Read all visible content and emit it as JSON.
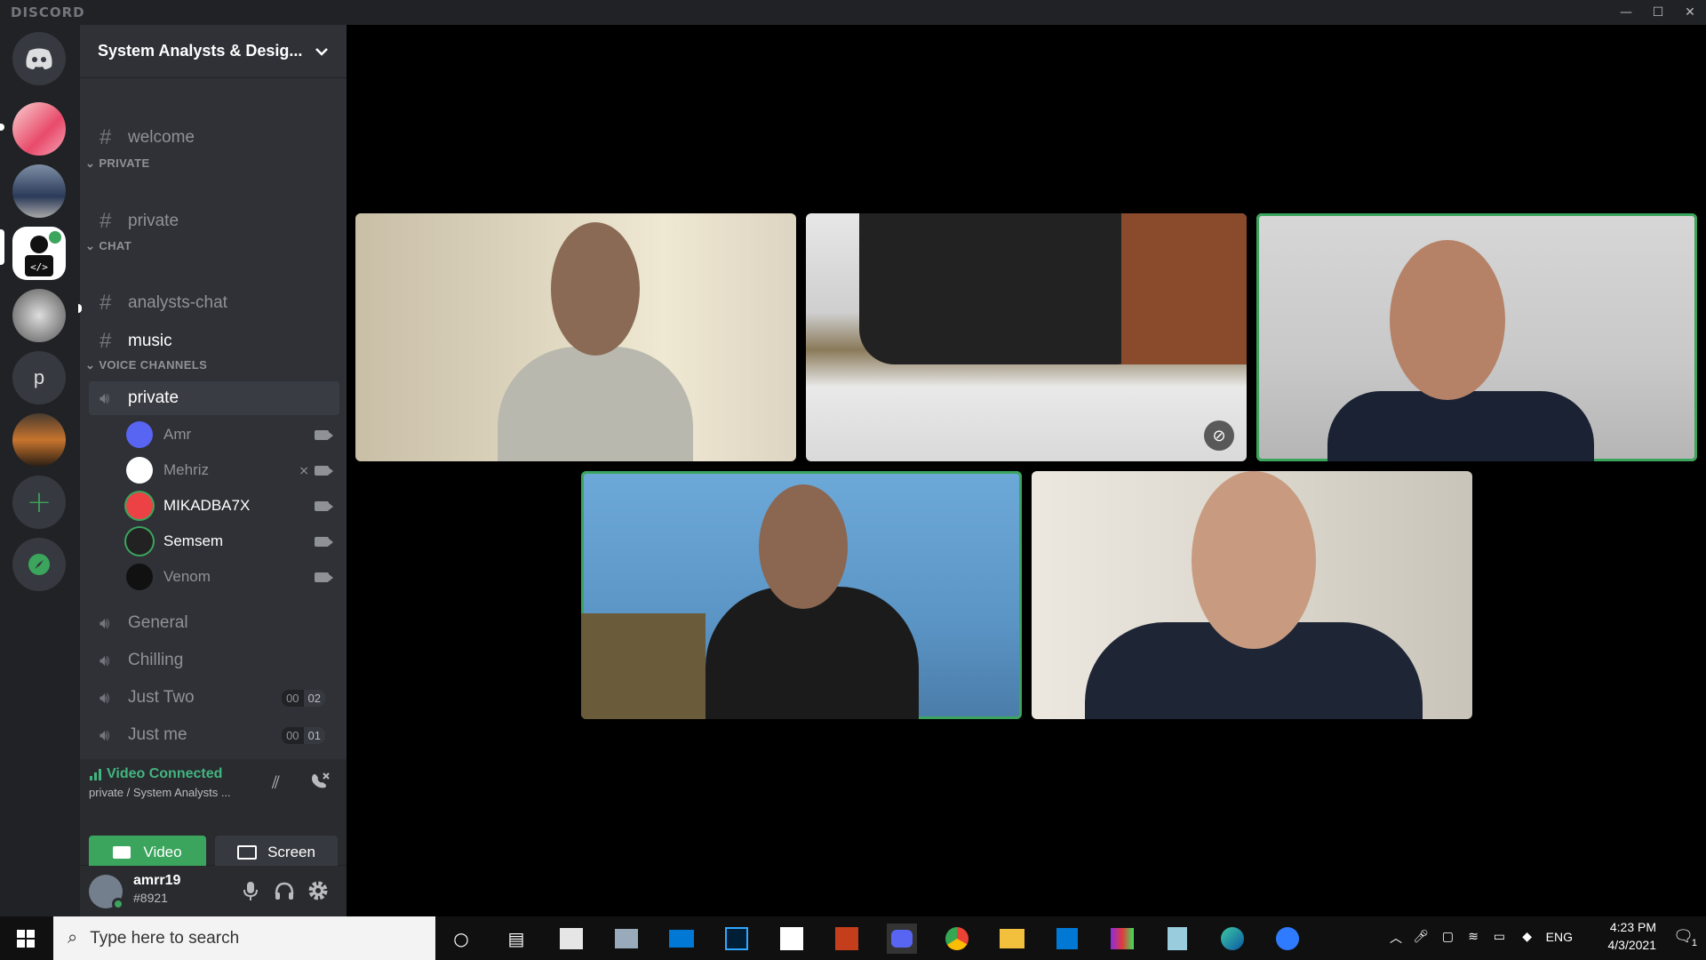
{
  "app": {
    "brand": "DISCORD"
  },
  "window_controls": [
    "—",
    "☐",
    "✕"
  ],
  "server": {
    "name": "System Analysts & Desig..."
  },
  "channels": {
    "welcome": "welcome",
    "cat_private": "PRIVATE",
    "private": "private",
    "cat_chat": "CHAT",
    "analysts_chat": "analysts-chat",
    "music": "music",
    "cat_voice": "VOICE CHANNELS",
    "voice_private": "private",
    "voice_general": "General",
    "voice_chilling": "Chilling",
    "voice_just_two": "Just Two",
    "voice_just_me": "Just me",
    "just_two_count": [
      "00",
      "02"
    ],
    "just_me_count": [
      "00",
      "01"
    ]
  },
  "members": [
    {
      "name": "Amr"
    },
    {
      "name": "Mehriz"
    },
    {
      "name": "MIKADBA7X"
    },
    {
      "name": "Semsem"
    },
    {
      "name": "Venom"
    }
  ],
  "voice_panel": {
    "status": "Video Connected",
    "sub": "private / System Analysts ...",
    "video_label": "Video",
    "screen_label": "Screen"
  },
  "user": {
    "name": "amrr19",
    "tag": "#8921"
  },
  "taskbar": {
    "search_placeholder": "Type here to search",
    "lang": "ENG",
    "time": "4:23 PM",
    "date": "4/3/2021",
    "notif_count": "1"
  },
  "colors": {
    "green": "#3ba55d",
    "blurple": "#5865f2",
    "rail": "#202225",
    "sidebar": "#2f3136"
  }
}
